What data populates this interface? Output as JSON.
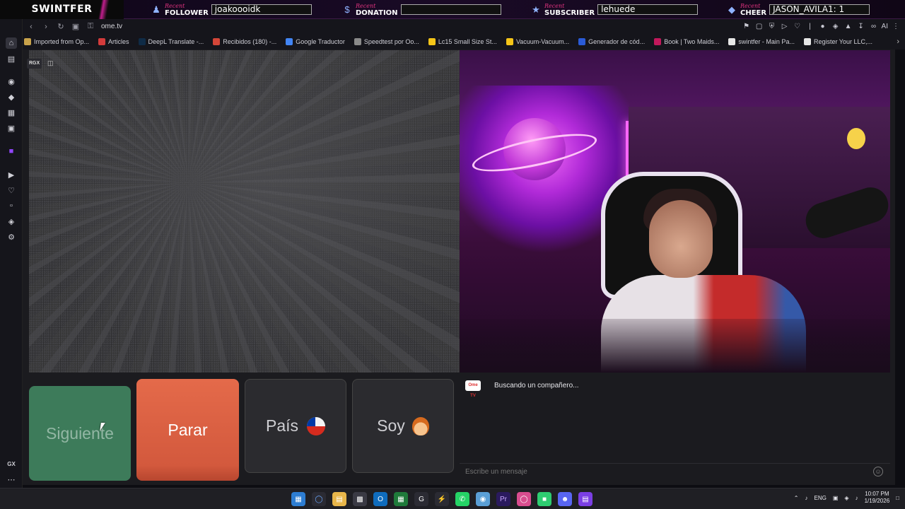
{
  "overlay": {
    "brand": "SWINTFER",
    "alerts": [
      {
        "recent": "Recent",
        "kind": "FOLLOWER",
        "value": "joakoooidk"
      },
      {
        "recent": "Recent",
        "kind": "DONATION",
        "value": ""
      },
      {
        "recent": "Recent",
        "kind": "SUBSCRIBER",
        "value": "lehuede"
      },
      {
        "recent": "Recent",
        "kind": "CHEER",
        "value": "JASON_AVILA1: 1"
      }
    ]
  },
  "browser": {
    "url": "ome.tv",
    "bookmarks": [
      {
        "label": "Imported from Op...",
        "color": "#c8a24a"
      },
      {
        "label": "Articles",
        "color": "#d33b3b"
      },
      {
        "label": "DeepL Translate -...",
        "color": "#0f2b46"
      },
      {
        "label": "Recibidos (180) -...",
        "color": "#d44638"
      },
      {
        "label": "Google Traductor",
        "color": "#4285f4"
      },
      {
        "label": "Speedtest por Oo...",
        "color": "#8a8a8a"
      },
      {
        "label": "Lc15 Small Size St...",
        "color": "#f5c518"
      },
      {
        "label": "Vacuum-Vacuum...",
        "color": "#f5c518"
      },
      {
        "label": "Generador de cód...",
        "color": "#2a5bd7"
      },
      {
        "label": "Book | Two Maids...",
        "color": "#c2185b"
      },
      {
        "label": "swintfer - Main Pa...",
        "color": "#e6e6e6"
      },
      {
        "label": "Register Your LLC,...",
        "color": "#e6e6e6"
      }
    ],
    "extension_ai_label": "AI"
  },
  "sidebar": {
    "bottom_label": "GX"
  },
  "remote_video": {
    "badge": "RGX"
  },
  "controls": {
    "next_label": "Siguiente",
    "stop_label": "Parar",
    "country_label": "País",
    "gender_label": "Soy"
  },
  "chat": {
    "logo_text": "Ome TV",
    "status": "Buscando un compañero...",
    "input_placeholder": "Escribe un mensaje"
  },
  "taskbar": {
    "language": "ENG",
    "time": "10:07 PM",
    "date": "1/19/2026"
  },
  "colors": {
    "next_button": "#3d7b5a",
    "stop_button": "#e46a4a",
    "accent": "#c01f8d"
  }
}
